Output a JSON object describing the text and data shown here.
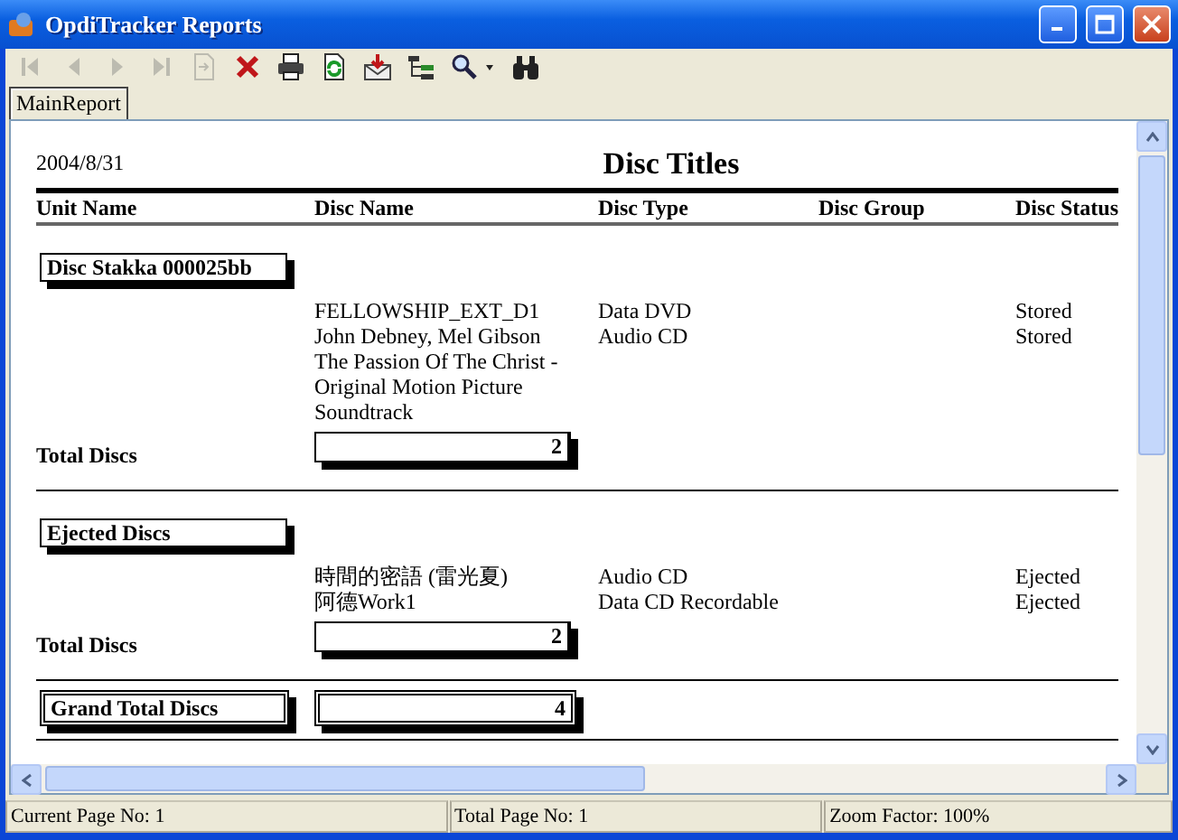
{
  "window": {
    "title": "OpdiTracker Reports"
  },
  "toolbar": [
    {
      "kind": "first",
      "disabled": true
    },
    {
      "kind": "prev",
      "disabled": true
    },
    {
      "kind": "next",
      "disabled": true
    },
    {
      "kind": "last",
      "disabled": true
    },
    {
      "kind": "goto",
      "disabled": true
    },
    {
      "kind": "close",
      "disabled": false
    },
    {
      "kind": "print",
      "disabled": false
    },
    {
      "kind": "refresh",
      "disabled": false
    },
    {
      "kind": "export",
      "disabled": false
    },
    {
      "kind": "tree",
      "disabled": false
    },
    {
      "kind": "zoom",
      "disabled": false
    },
    {
      "kind": "find",
      "disabled": false
    }
  ],
  "tabs": [
    {
      "label": "MainReport",
      "selected": true
    }
  ],
  "report": {
    "date": "2004/8/31",
    "title": "Disc Titles",
    "columns": [
      "Unit Name",
      "Disc Name",
      "Disc Type",
      "Disc Group",
      "Disc Status"
    ],
    "groups": [
      {
        "unit": "Disc Stakka 000025bb",
        "discs": [
          {
            "name": "FELLOWSHIP_EXT_D1",
            "type": "Data DVD",
            "status": "Stored"
          },
          {
            "name": "John Debney, Mel Gibson The Passion Of The Christ - Original Motion Picture Soundtrack",
            "type": "Audio CD",
            "status": "Stored"
          }
        ],
        "total_label": "Total Discs",
        "total": "2"
      },
      {
        "unit": "Ejected Discs",
        "discs": [
          {
            "name": "時間的密語 (雷光夏)",
            "type": "Audio CD",
            "status": "Ejected"
          },
          {
            "name": "阿德Work1",
            "type": "Data CD Recordable",
            "status": "Ejected"
          }
        ],
        "total_label": "Total Discs",
        "total": "2"
      }
    ],
    "grand_total_label": "Grand Total Discs",
    "grand_total": "4"
  },
  "status_bar": [
    "Current Page No: 1",
    "Total Page No: 1",
    "Zoom Factor: 100%"
  ]
}
